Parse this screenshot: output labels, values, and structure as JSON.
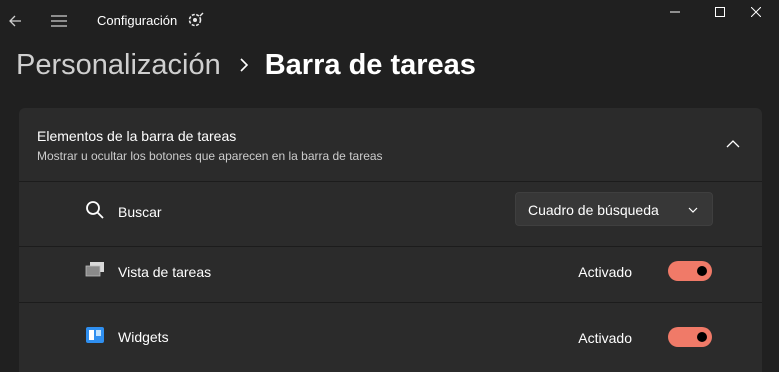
{
  "window": {
    "title": "Configuración",
    "controls": [
      "minimize",
      "maximize",
      "close"
    ]
  },
  "breadcrumb": {
    "parent": "Personalización",
    "current": "Barra de tareas"
  },
  "section": {
    "title": "Elementos de la barra de tareas",
    "subtitle": "Mostrar u ocultar los botones que aparecen en la barra de tareas",
    "expanded": true,
    "items": [
      {
        "label": "Buscar",
        "icon": "search-icon",
        "control": "dropdown",
        "value": "Cuadro de búsqueda"
      },
      {
        "label": "Vista de tareas",
        "icon": "task-view-icon",
        "control": "toggle",
        "state_label": "Activado",
        "on": true
      },
      {
        "label": "Widgets",
        "icon": "widgets-icon",
        "control": "toggle",
        "state_label": "Activado",
        "on": true
      }
    ]
  },
  "colors": {
    "background": "#202020",
    "card": "#2b2b2b",
    "accent": "#f07a68",
    "divider": "#1c1c1c"
  }
}
